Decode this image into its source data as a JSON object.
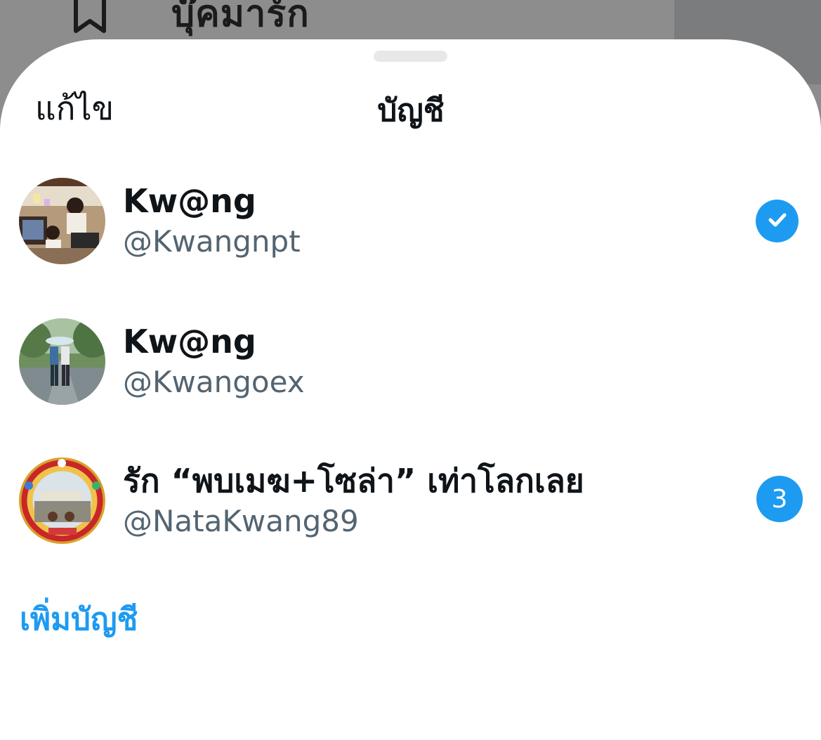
{
  "background_menu": {
    "icon": "bookmark-icon",
    "label": "บุ๊คมาร์ก"
  },
  "sheet": {
    "edit_label": "แก้ไข",
    "title": "บัญชี",
    "add_account_label": "เพิ่มบัญชี"
  },
  "accounts": [
    {
      "name": "Kw@ng",
      "handle": "@Kwangnpt",
      "selected": true,
      "badge_icon": "checkmark-icon"
    },
    {
      "name": "Kw@ng",
      "handle": "@Kwangoex",
      "selected": false
    },
    {
      "name": "รัก “พบเมฆ+โซล่า” เท่าโลกเลย",
      "handle": "@NataKwang89",
      "selected": false,
      "unread_count": "3"
    }
  ],
  "colors": {
    "accent": "#1d9bf0",
    "primary_text": "#0f1419",
    "secondary_text": "#536471",
    "backdrop": "#8d8d8d"
  }
}
